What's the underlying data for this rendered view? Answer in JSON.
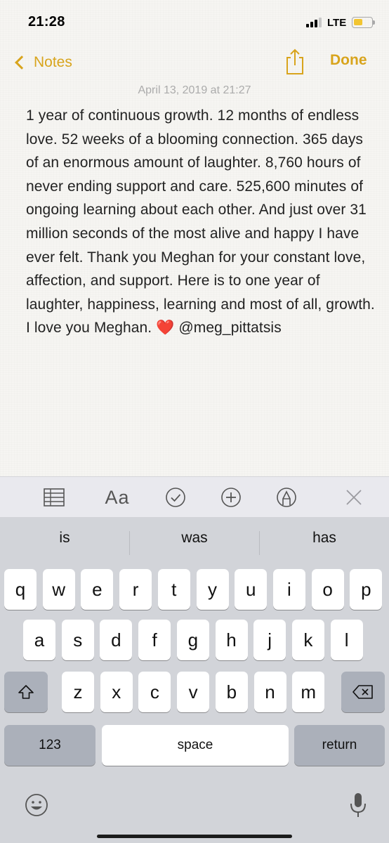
{
  "status_bar": {
    "time": "21:28",
    "network": "LTE",
    "battery_level": 0.5,
    "battery_color": "#f2c531"
  },
  "nav": {
    "back_label": "Notes",
    "share_icon": "share-icon",
    "done_label": "Done",
    "accent_color": "#d8a41c"
  },
  "note": {
    "date": "April 13, 2019 at 21:27",
    "body": "1 year of continuous growth. 12 months of endless love. 52 weeks of a blooming connection. 365 days of an enormous amount of laughter. 8,760 hours of never ending support and care. 525,600 minutes of ongoing learning about each other. And just over 31 million seconds of the most alive and happy I have ever felt. Thank you Meghan for your constant love, affection, and support. Here is to one year of laughter, happiness, learning and most of all, growth. I love you Meghan. ❤️ @meg_pittatsis"
  },
  "toolbar": {
    "table_icon": "table-icon",
    "format_label": "Aa",
    "checklist_icon": "checklist-icon",
    "add_icon": "plus-circle-icon",
    "markup_icon": "markup-pen-icon",
    "close_icon": "close-icon"
  },
  "keyboard": {
    "predictions": [
      "is",
      "was",
      "has"
    ],
    "row1": [
      "q",
      "w",
      "e",
      "r",
      "t",
      "y",
      "u",
      "i",
      "o",
      "p"
    ],
    "row2": [
      "a",
      "s",
      "d",
      "f",
      "g",
      "h",
      "j",
      "k",
      "l"
    ],
    "row3": [
      "z",
      "x",
      "c",
      "v",
      "b",
      "n",
      "m"
    ],
    "numbers_label": "123",
    "space_label": "space",
    "return_label": "return",
    "shift_icon": "shift-icon",
    "delete_icon": "backspace-icon",
    "emoji_icon": "emoji-icon",
    "dictation_icon": "microphone-icon"
  }
}
